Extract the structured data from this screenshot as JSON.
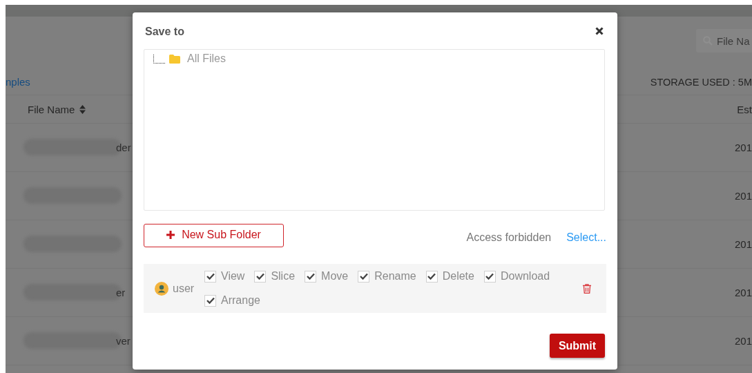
{
  "background": {
    "search": {
      "placeholder": "File Na"
    },
    "link": "nples",
    "storage": "STORAGE USED : 5M",
    "columns": [
      "File Name",
      "Est"
    ],
    "rows": [
      {
        "name_tail": "der",
        "date": "201"
      },
      {
        "date": "201"
      },
      {
        "date": "201"
      },
      {
        "name_tail": "er",
        "date": "201"
      },
      {
        "name_tail": "ver",
        "date": "201"
      }
    ]
  },
  "dialog": {
    "title": "Save to",
    "tree": [
      {
        "label": "All Files"
      }
    ],
    "new_folder_button": "New Sub Folder",
    "access_label": "Access forbidden",
    "select_link": "Select...",
    "permissions": [
      {
        "user": "user",
        "rights": [
          {
            "label": "View",
            "checked": true
          },
          {
            "label": "Slice",
            "checked": true
          },
          {
            "label": "Move",
            "checked": true
          },
          {
            "label": "Rename",
            "checked": true
          },
          {
            "label": "Delete",
            "checked": true
          },
          {
            "label": "Download",
            "checked": true
          },
          {
            "label": "Arrange",
            "checked": true
          }
        ]
      }
    ],
    "submit": "Submit"
  }
}
